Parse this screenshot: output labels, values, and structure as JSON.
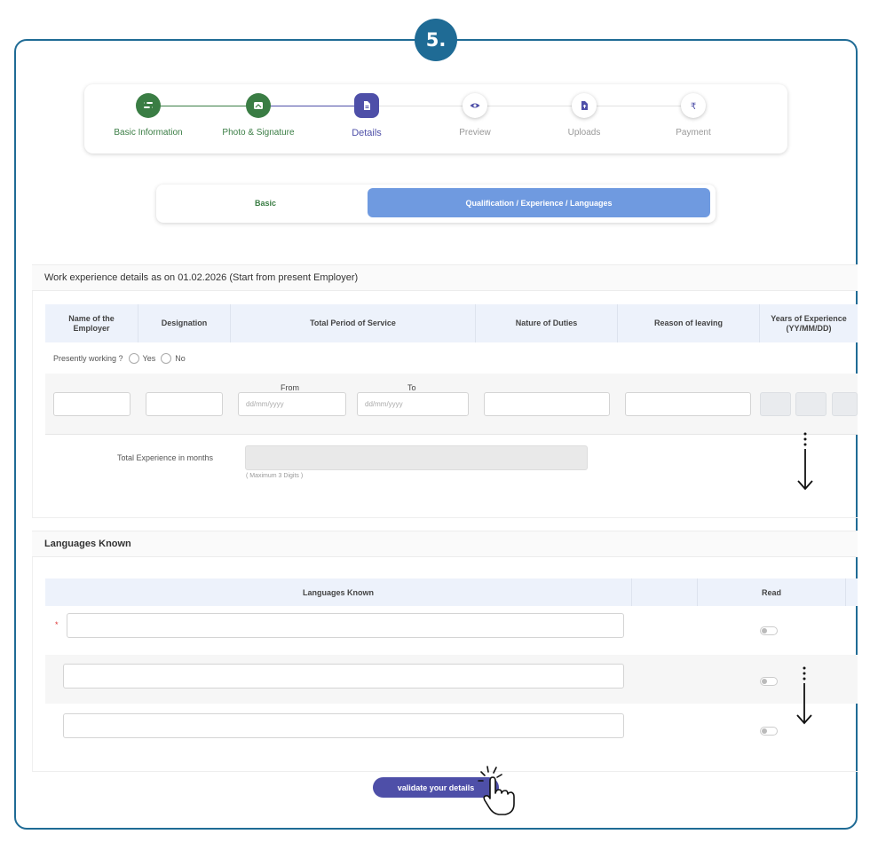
{
  "step_number": "5.",
  "stepper": [
    {
      "label": "Basic Information",
      "state": "done",
      "icon": "list-icon"
    },
    {
      "label": "Photo & Signature",
      "state": "done",
      "icon": "photo-icon"
    },
    {
      "label": "Details",
      "state": "active",
      "icon": "document-icon"
    },
    {
      "label": "Preview",
      "state": "pending",
      "icon": "eye-icon"
    },
    {
      "label": "Uploads",
      "state": "pending",
      "icon": "upload-file-icon"
    },
    {
      "label": "Payment",
      "state": "pending",
      "icon": "rupee-icon"
    }
  ],
  "tabs": {
    "basic": "Basic",
    "qualification": "Qualification / Experience / Languages"
  },
  "work": {
    "title": "Work experience details as on 01.02.2026 (Start from present Employer)",
    "columns": [
      "Name of the Employer",
      "Designation",
      "Total Period of Service",
      "Nature of Duties",
      "Reason of leaving",
      "Years of Experience (YY/MM/DD)"
    ],
    "presently_working": "Presently working ?",
    "yes": "Yes",
    "no": "No",
    "from": "From",
    "to": "To",
    "date_placeholder": "dd/mm/yyyy",
    "total_label": "Total Experience in months",
    "total_hint": "( Maximum 3 Digits )"
  },
  "languages": {
    "title": "Languages Known",
    "col_languages": "Languages Known",
    "col_read": "Read",
    "required_mark": "*"
  },
  "validate_button": "validate your details",
  "colors": {
    "frame": "#1f6b95",
    "done": "#3a7d44",
    "active": "#4e4fa8",
    "tab_active": "#6f9ae0"
  }
}
